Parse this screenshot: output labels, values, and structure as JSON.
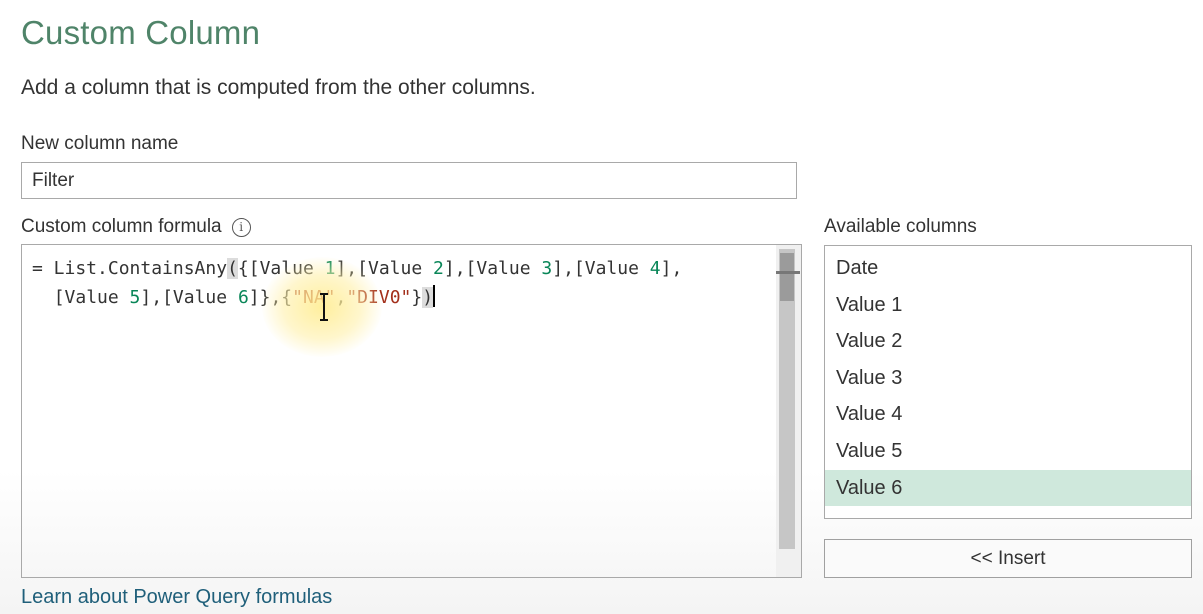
{
  "dialog": {
    "title": "Custom Column",
    "description": "Add a column that is computed from the other columns."
  },
  "name_field": {
    "label": "New column name",
    "value": "Filter"
  },
  "formula": {
    "label": "Custom column formula",
    "info_icon": "info-icon",
    "line1_prefix": "= List.ContainsAny",
    "line1_open_paren": "(",
    "line1_rest_a": "{[Value ",
    "n1": "1",
    "line1_rest_b": "],[Value ",
    "n2": "2",
    "line1_rest_c": "],[Value ",
    "n3": "3",
    "line1_rest_d": "],[Value ",
    "n4": "4",
    "line1_rest_e": "],",
    "line2_indent": "  ",
    "line2_a": "[Value ",
    "n5": "5",
    "line2_b": "],[Value ",
    "n6": "6",
    "line2_c": "]},{",
    "str1": "\"NA\"",
    "comma": ",",
    "str2": "\"DIV0\"",
    "line2_close_brace": "}",
    "line2_close_paren": ")"
  },
  "available_columns": {
    "label": "Available columns",
    "items": [
      "Date",
      "Value 1",
      "Value 2",
      "Value 3",
      "Value 4",
      "Value 5",
      "Value 6"
    ],
    "selected": "Value 6"
  },
  "insert_button": {
    "label": "<< Insert"
  },
  "learn_link": {
    "label": "Learn about Power Query formulas"
  },
  "colors": {
    "title": "#4f8469",
    "selection": "#cfe8dc",
    "string": "#a3301c",
    "number": "#098658",
    "link": "#1f5f7a"
  }
}
